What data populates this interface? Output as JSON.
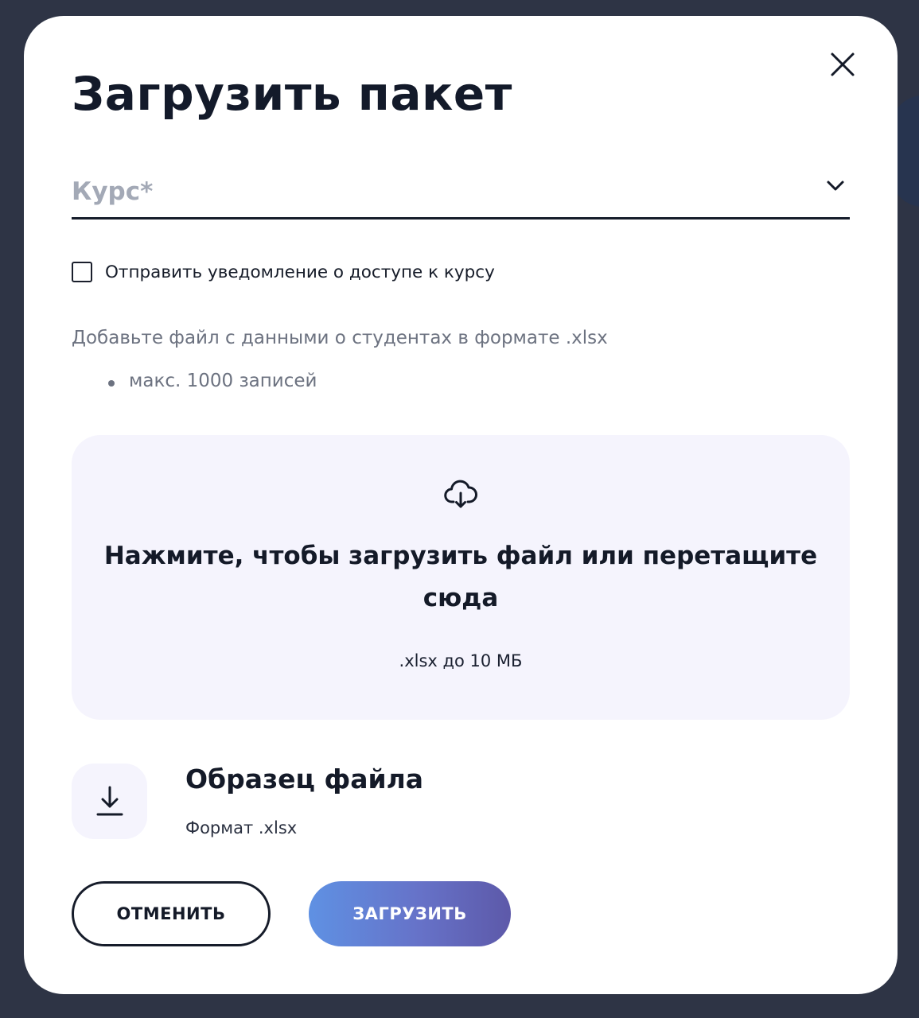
{
  "modal": {
    "title": "Загрузить пакет",
    "close_icon": "close-icon"
  },
  "course_select": {
    "placeholder": "Курс*",
    "icon": "chevron-down-icon"
  },
  "notify_checkbox": {
    "label": "Отправить уведомление о доступе к курсу",
    "checked": false
  },
  "file_hint": {
    "text": "Добавьте файл с данными о студентах в формате .xlsx",
    "bullets": [
      "макс. 1000 записей"
    ]
  },
  "dropzone": {
    "icon": "cloud-download-icon",
    "title": "Нажмите, чтобы загрузить файл или перетащите сюда",
    "subtitle": ".xlsx до 10 МБ",
    "background": "#f5f4fd"
  },
  "sample_file": {
    "icon": "download-icon",
    "title": "Образец файла",
    "subtitle": "Формат .xlsx"
  },
  "actions": {
    "cancel_label": "ОТМЕНИТЬ",
    "upload_label": "ЗАГРУЗИТЬ"
  },
  "colors": {
    "backdrop": "#2e3445",
    "text_primary": "#141a28",
    "text_muted": "#6c7280",
    "placeholder": "#a3a9b6",
    "upload_gradient_start": "#5f91e3",
    "upload_gradient_end": "#5d59a9"
  }
}
